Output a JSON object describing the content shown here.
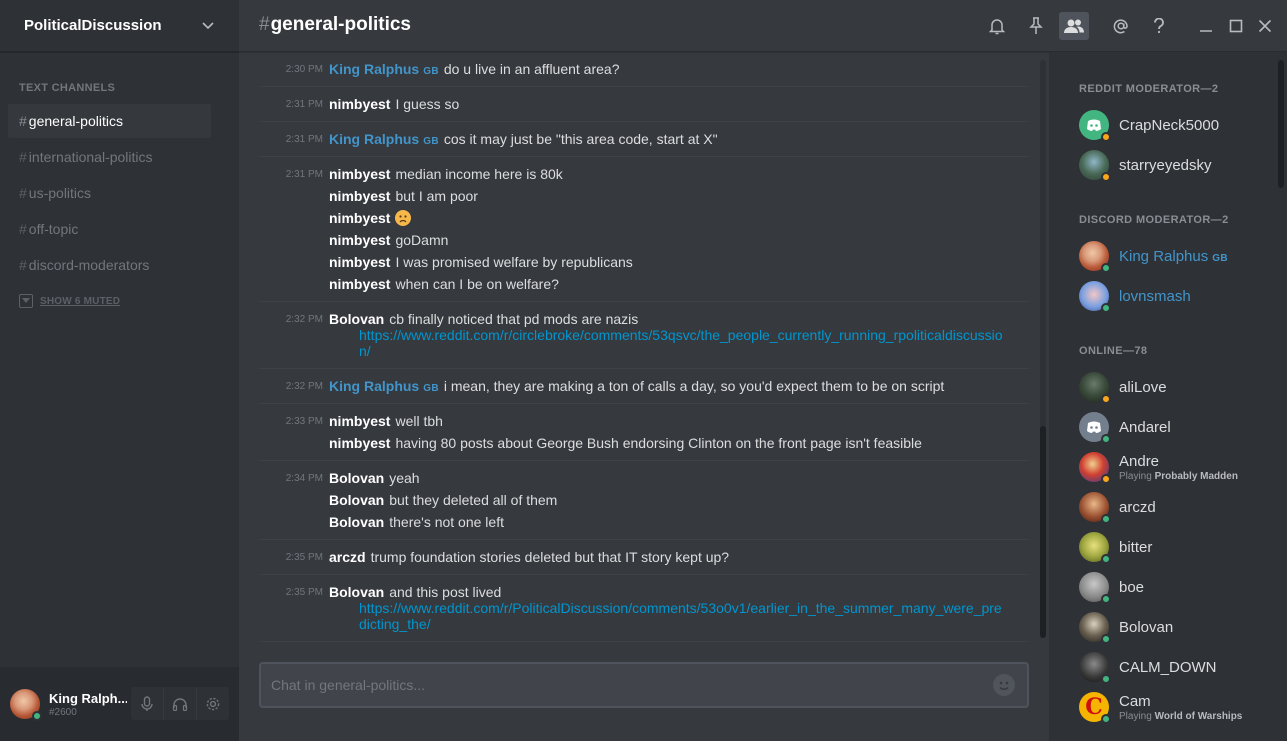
{
  "server": {
    "name": "PoliticalDiscussion"
  },
  "sidebar": {
    "channels_header": "TEXT CHANNELS",
    "channels": [
      {
        "name": "general-politics",
        "active": true
      },
      {
        "name": "international-politics",
        "active": false
      },
      {
        "name": "us-politics",
        "active": false
      },
      {
        "name": "off-topic",
        "active": false
      },
      {
        "name": "discord-moderators",
        "active": false
      }
    ],
    "muted_label": "SHOW 6 MUTED"
  },
  "user": {
    "name": "King Ralph...",
    "tag": "#2600"
  },
  "header": {
    "hash": "#",
    "channel": "general-politics"
  },
  "messages": [
    {
      "time": "2:30 PM",
      "author": "King Ralphus",
      "badge": "GB",
      "text": "do u live in an affluent area?"
    },
    {
      "time": "2:31 PM",
      "author": "nimbyest",
      "text": "I guess so"
    },
    {
      "time": "2:31 PM",
      "author": "King Ralphus",
      "badge": "GB",
      "text": "cos it may just be \"this area code, start at X\""
    },
    {
      "time": "2:31 PM",
      "author": "nimbyest",
      "text": "median income here is 80k"
    },
    {
      "author": "nimbyest",
      "text": "but I am poor"
    },
    {
      "author": "nimbyest",
      "emoji": "frowning-face-emoji"
    },
    {
      "author": "nimbyest",
      "text": "goDamn"
    },
    {
      "author": "nimbyest",
      "text": "I was promised welfare by republicans"
    },
    {
      "author": "nimbyest",
      "text": "when can I be on welfare?"
    },
    {
      "time": "2:32 PM",
      "author": "Bolovan",
      "text": "cb finally noticed that pd mods are nazis",
      "link": "https://www.reddit.com/r/circlebroke/comments/53qsvc/the_people_currently_running_rpoliticaldiscussion/"
    },
    {
      "time": "2:32 PM",
      "author": "King Ralphus",
      "badge": "GB",
      "text": "i mean, they are making a ton of calls a day, so you'd expect them to be on script"
    },
    {
      "time": "2:33 PM",
      "author": "nimbyest",
      "text": "well tbh"
    },
    {
      "author": "nimbyest",
      "text": "having 80 posts about George Bush endorsing Clinton on the front page isn't feasible"
    },
    {
      "time": "2:34 PM",
      "author": "Bolovan",
      "text": "yeah"
    },
    {
      "author": "Bolovan",
      "text": "but they deleted all of them"
    },
    {
      "author": "Bolovan",
      "text": "there's not one left"
    },
    {
      "time": "2:35 PM",
      "author": "arczd",
      "text": "trump foundation stories deleted but that IT story kept up?"
    },
    {
      "time": "2:35 PM",
      "author": "Bolovan",
      "text": "and this post lived",
      "link": "https://www.reddit.com/r/PoliticalDiscussion/comments/53o0v1/earlier_in_the_summer_many_were_predicting_the/"
    }
  ],
  "input": {
    "placeholder": "Chat in general-politics..."
  },
  "members": {
    "sections": [
      {
        "title": "REDDIT MODERATOR—2",
        "members": [
          {
            "name": "CrapNeck5000",
            "status": "idle",
            "avatar": "discord-logo"
          },
          {
            "name": "starryeyedsky",
            "status": "idle",
            "avatar": "photo"
          }
        ]
      },
      {
        "title": "DISCORD MODERATOR—2",
        "members": [
          {
            "name": "King Ralphus",
            "badge": "GB",
            "status": "online",
            "avatar": "photo"
          },
          {
            "name": "lovnsmash",
            "status": "online",
            "avatar": "photo"
          }
        ]
      },
      {
        "title": "ONLINE—78",
        "members": [
          {
            "name": "aliLove",
            "status": "idle",
            "avatar": "photo"
          },
          {
            "name": "Andarel",
            "status": "online",
            "avatar": "discord-logo"
          },
          {
            "name": "Andre",
            "status": "idle",
            "avatar": "photo",
            "playing_prefix": "Playing",
            "game": "Probably Madden"
          },
          {
            "name": "arczd",
            "status": "online",
            "avatar": "photo"
          },
          {
            "name": "bitter",
            "status": "online",
            "avatar": "photo"
          },
          {
            "name": "boe",
            "status": "online",
            "avatar": "photo"
          },
          {
            "name": "Bolovan",
            "status": "online",
            "avatar": "photo"
          },
          {
            "name": "CALM_DOWN",
            "status": "online",
            "avatar": "photo"
          },
          {
            "name": "Cam",
            "status": "online",
            "avatar": "photo",
            "playing_prefix": "Playing",
            "game": "World of Warships"
          }
        ]
      }
    ]
  },
  "colors": {
    "accent_blue": "#4295ca",
    "link": "#0096cf",
    "online": "#43b581",
    "idle": "#faa61a"
  }
}
